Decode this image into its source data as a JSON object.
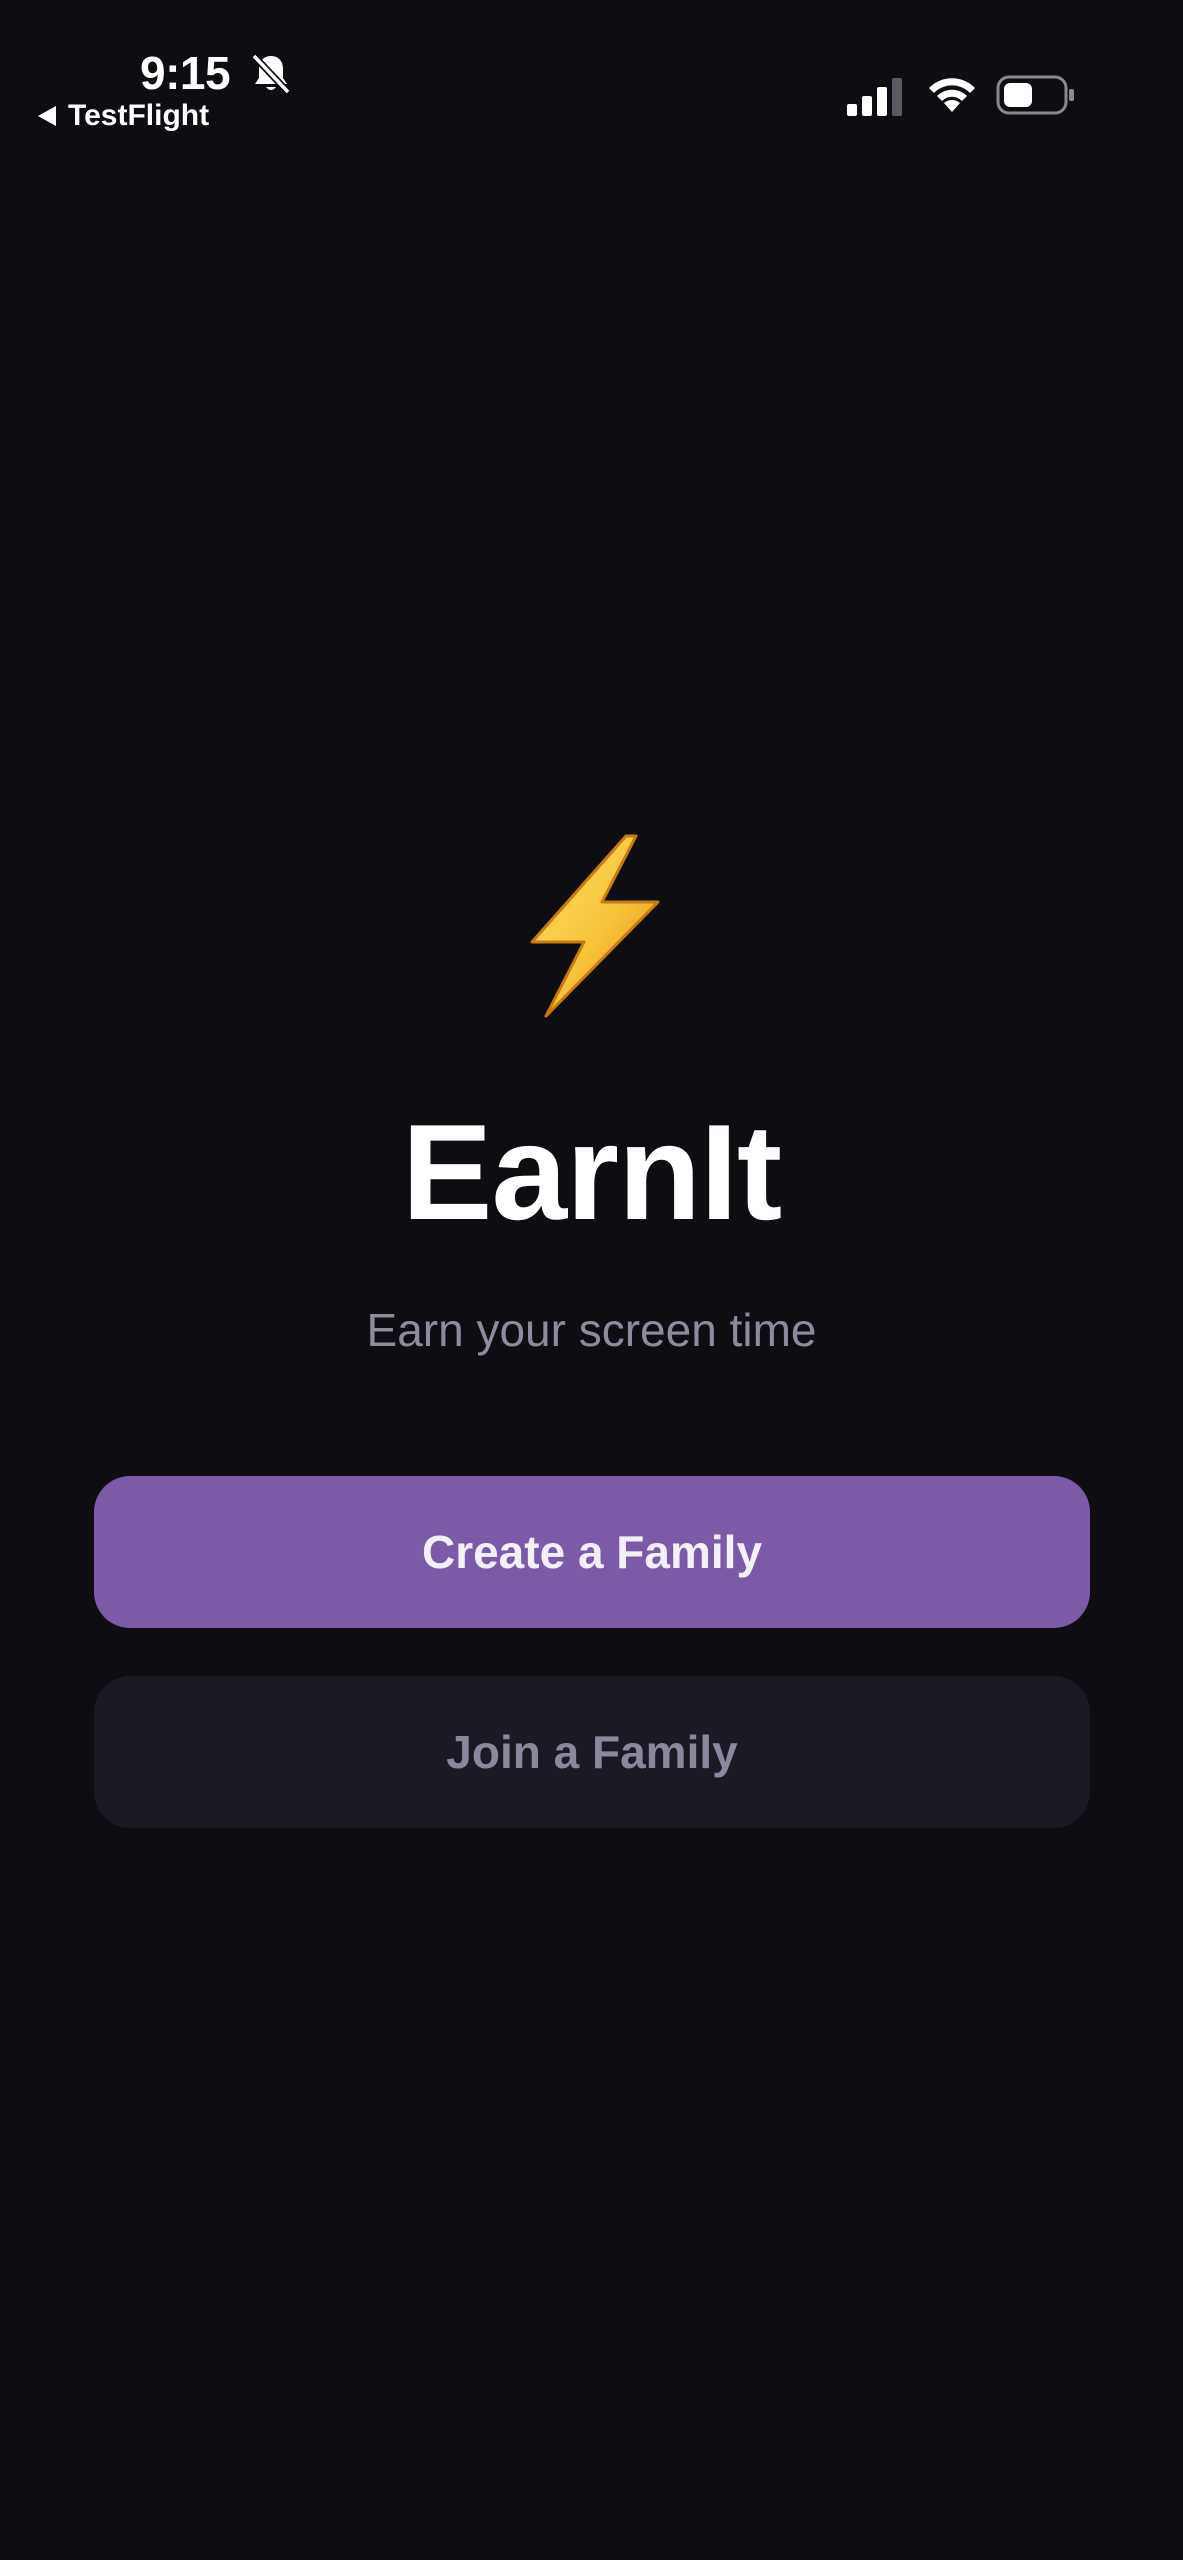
{
  "status_bar": {
    "time": "9:15",
    "back_label": "TestFlight",
    "icons": [
      "bell-off-icon",
      "signal-icon",
      "wifi-icon",
      "battery-icon"
    ],
    "battery_level_percent": 50
  },
  "main": {
    "logo_icon": "high-voltage-emoji",
    "title": "EarnIt",
    "subtitle": "Earn your screen time",
    "create_family_label": "Create a Family",
    "join_family_label": "Join a Family"
  },
  "colors": {
    "background": "#0e0d12",
    "primary_button": "#7b5ba8",
    "secondary_button": "#1b1a24",
    "subtitle_text": "#8f8b9e",
    "secondary_button_text": "#8c879c",
    "bolt": "#f7c33a"
  }
}
